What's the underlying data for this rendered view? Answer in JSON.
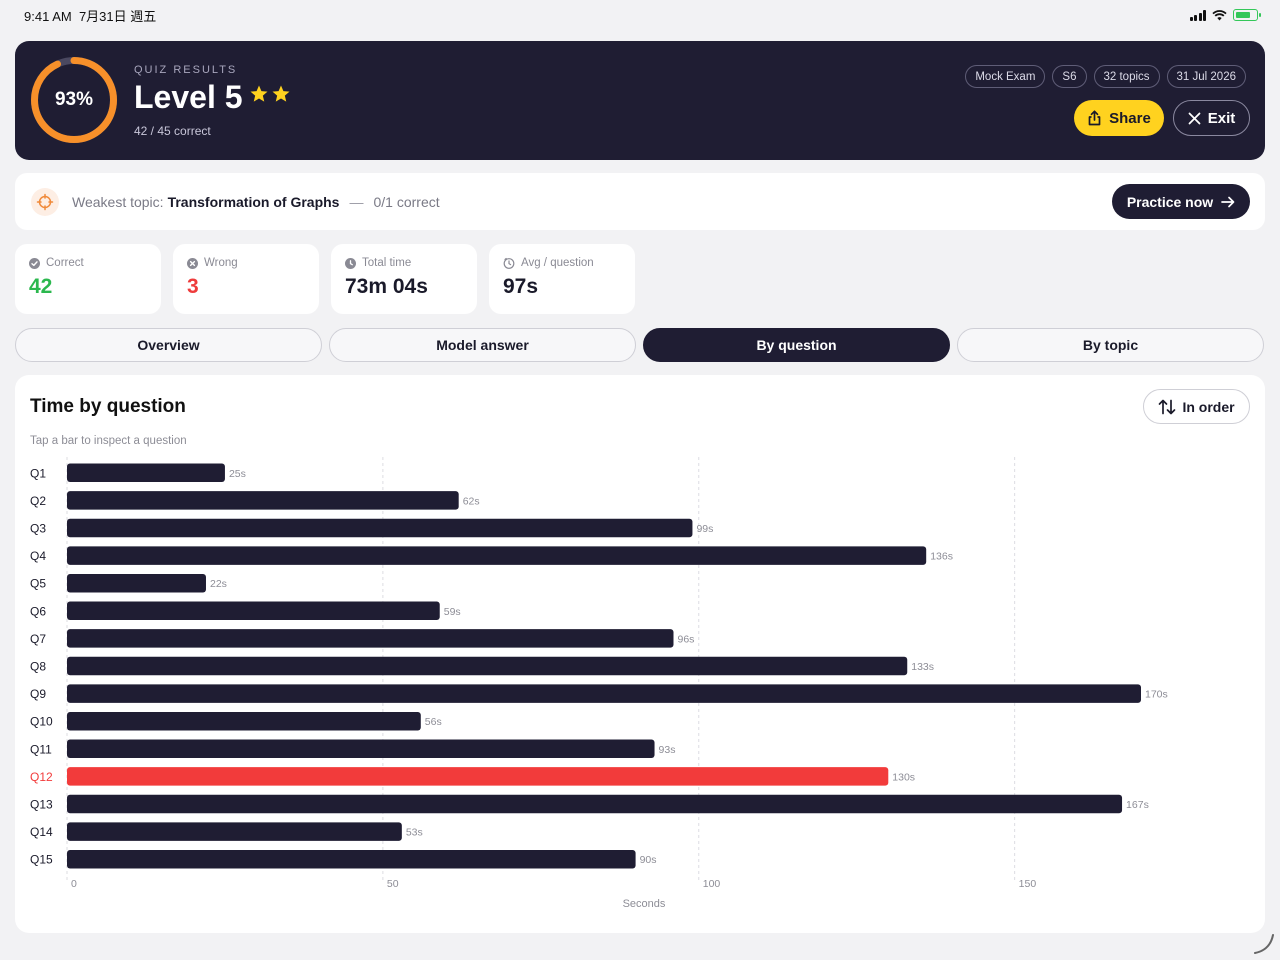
{
  "status_bar": {
    "time": "9:41 AM",
    "date": "7月31日 週五"
  },
  "hero": {
    "percent": "93%",
    "score_fraction": 0.93,
    "eyebrow": "QUIZ RESULTS",
    "level": "Level 5",
    "stars": 2,
    "correct_summary": "42 / 45 correct",
    "chips": [
      "Mock Exam",
      "S6",
      "32 topics",
      "31 Jul 2026"
    ],
    "share_label": "Share",
    "exit_label": "Exit"
  },
  "weakest": {
    "prefix": "Weakest topic:",
    "topic": "Transformation of Graphs",
    "separator": "—",
    "score": "0/1 correct",
    "button": "Practice now"
  },
  "stats": [
    {
      "label": "Correct",
      "value": "42",
      "icon": "check-circle-icon",
      "tone": "green"
    },
    {
      "label": "Wrong",
      "value": "3",
      "icon": "x-circle-icon",
      "tone": "red"
    },
    {
      "label": "Total time",
      "value": "73m 04s",
      "icon": "clock-icon",
      "tone": "default"
    },
    {
      "label": "Avg / question",
      "value": "97s",
      "icon": "timer-icon",
      "tone": "default"
    }
  ],
  "tabs": [
    {
      "label": "Overview",
      "active": false
    },
    {
      "label": "Model answer",
      "active": false
    },
    {
      "label": "By question",
      "active": true
    },
    {
      "label": "By topic",
      "active": false
    }
  ],
  "panel": {
    "title": "Time by question",
    "hint": "Tap a bar to inspect a question",
    "sort_label": "In order"
  },
  "colors": {
    "navy": "#1f1d33",
    "accent_yellow": "#ffd21f",
    "ring_orange": "#f7902a",
    "highlight_red": "#f23b3b",
    "correct_green": "#2bb84e"
  },
  "chart_data": {
    "type": "bar",
    "orientation": "horizontal",
    "categories": [
      "Q1",
      "Q2",
      "Q3",
      "Q4",
      "Q5",
      "Q6",
      "Q7",
      "Q8",
      "Q9",
      "Q10",
      "Q11",
      "Q12",
      "Q13",
      "Q14",
      "Q15"
    ],
    "values": [
      25,
      62,
      99,
      136,
      22,
      59,
      96,
      133,
      170,
      56,
      93,
      130,
      167,
      53,
      90
    ],
    "data_labels": [
      "25s",
      "62s",
      "99s",
      "136s",
      "22s",
      "59s",
      "96s",
      "133s",
      "170s",
      "56s",
      "93s",
      "130s",
      "167s",
      "53s",
      "90s"
    ],
    "highlighted": [
      "Q12"
    ],
    "xlabel": "Seconds",
    "xticks": [
      0,
      50,
      100,
      150
    ],
    "xlim": [
      0,
      170
    ],
    "grid": true
  }
}
